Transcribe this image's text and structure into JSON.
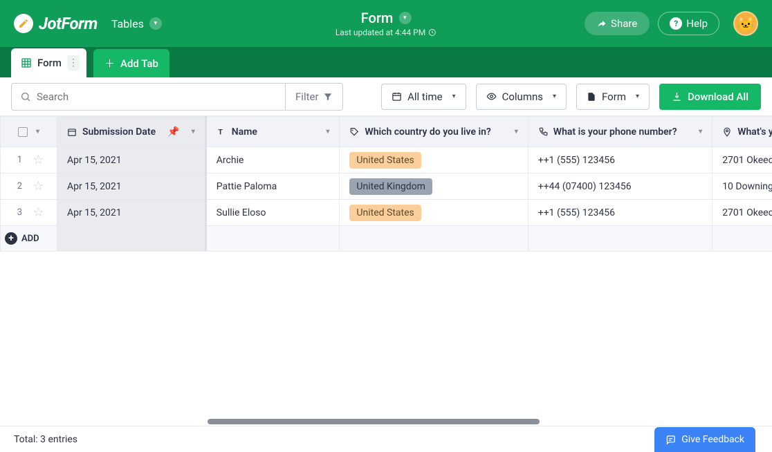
{
  "header": {
    "brand": "JotForm",
    "section": "Tables",
    "title": "Form",
    "last_updated": "Last updated at 4:44 PM",
    "share": "Share",
    "help": "Help"
  },
  "tabs": {
    "form": "Form",
    "add": "Add Tab"
  },
  "toolbar": {
    "search_placeholder": "Search",
    "filter": "Filter",
    "alltime": "All time",
    "columns": "Columns",
    "form": "Form",
    "download": "Download All"
  },
  "columns": {
    "date": "Submission Date",
    "name": "Name",
    "country": "Which country do you live in?",
    "phone": "What is your phone number?",
    "address": "What's y"
  },
  "rows": [
    {
      "n": "1",
      "date": "Apr 15, 2021",
      "name": "Archie",
      "country": "United States",
      "country_cls": "tag-us",
      "phone": "++1 (555) 123456",
      "addr": "2701 Okeec"
    },
    {
      "n": "2",
      "date": "Apr 15, 2021",
      "name": "Pattie Paloma",
      "country": "United Kingdom",
      "country_cls": "tag-uk",
      "phone": "++44 (07400) 123456",
      "addr": "10 Downing"
    },
    {
      "n": "3",
      "date": "Apr 15, 2021",
      "name": "Sullie Eloso",
      "country": "United States",
      "country_cls": "tag-us",
      "phone": "++1 (555) 123456",
      "addr": "2701 Okeec"
    }
  ],
  "add_row": "ADD",
  "footer": {
    "total": "Total: 3 entries",
    "feedback": "Give Feedback"
  }
}
